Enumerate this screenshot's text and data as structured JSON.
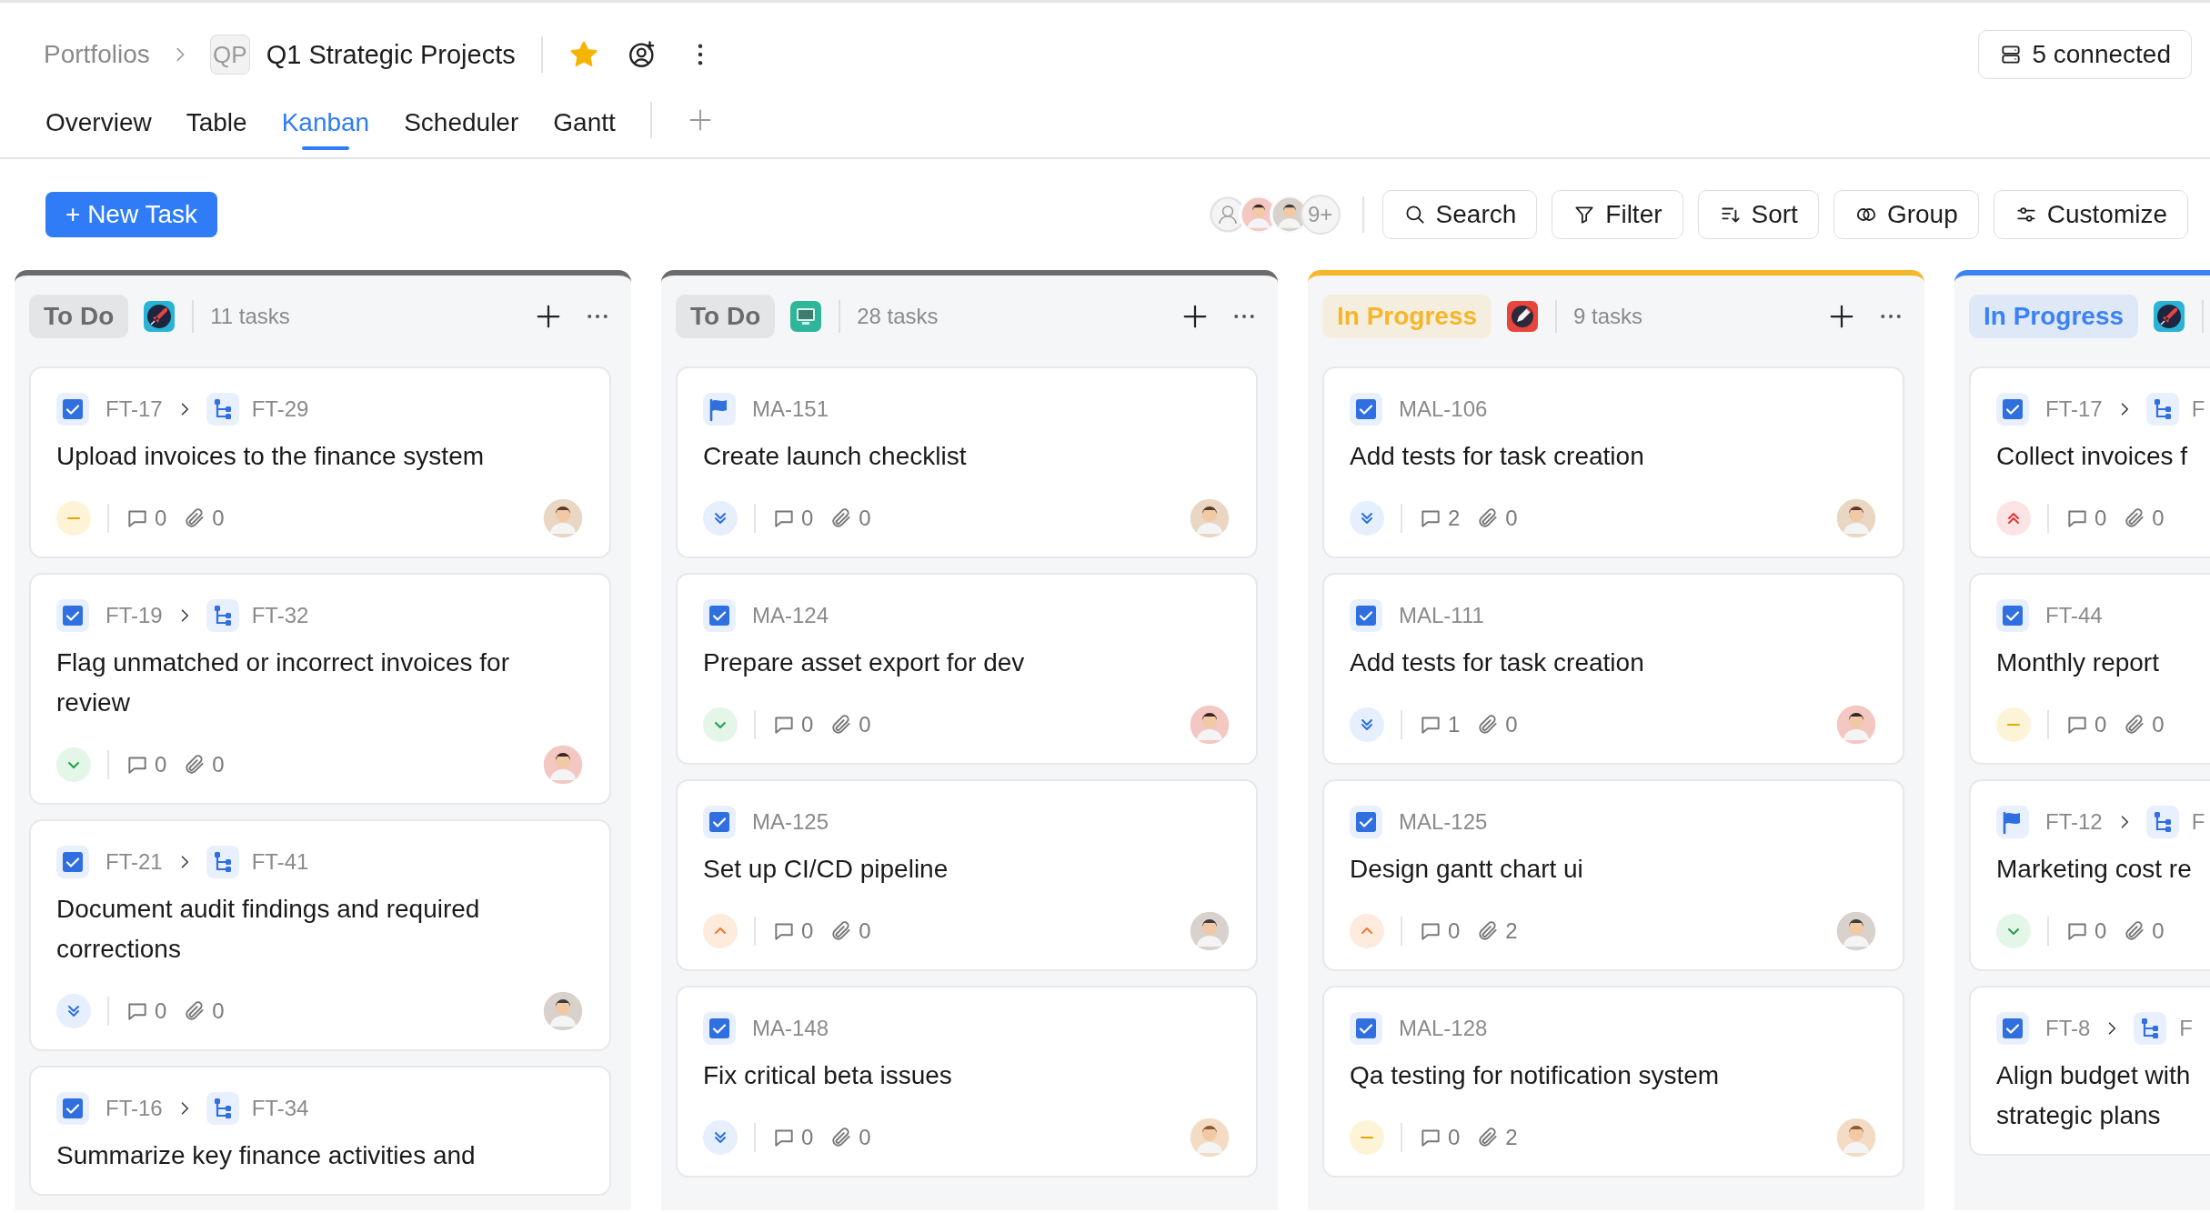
{
  "breadcrumb": {
    "parent": "Portfolios",
    "badge": "QP",
    "title": "Q1 Strategic Projects",
    "starred": true
  },
  "connections": "5 connected",
  "tabs": [
    {
      "label": "Overview",
      "selected": false
    },
    {
      "label": "Table",
      "selected": false
    },
    {
      "label": "Kanban",
      "selected": true
    },
    {
      "label": "Scheduler",
      "selected": false
    },
    {
      "label": "Gantt",
      "selected": false
    }
  ],
  "toolbar": {
    "new_task": "+ New Task",
    "members_more": "9+",
    "buttons": [
      "Search",
      "Filter",
      "Sort",
      "Group",
      "Customize"
    ]
  },
  "columns": [
    {
      "status": "To Do",
      "color": "#6b6b6b",
      "kind": "rocket",
      "count": "11 tasks",
      "cards": [
        {
          "kind": "task",
          "id": "FT-17",
          "child": "FT-29",
          "title": "Upload invoices to the finance system",
          "priority": {
            "kind": "medium"
          },
          "comments": "0",
          "attachments": "0"
        },
        {
          "kind": "task",
          "id": "FT-19",
          "child": "FT-32",
          "title": "Flag unmatched or incorrect invoices for review",
          "priority": {
            "kind": "low"
          },
          "comments": "0",
          "attachments": "0"
        },
        {
          "kind": "task",
          "id": "FT-21",
          "child": "FT-41",
          "title": "Document audit findings and required corrections",
          "priority": {
            "kind": "lowest"
          },
          "comments": "0",
          "attachments": "0"
        },
        {
          "kind": "task",
          "id": "FT-16",
          "child": "FT-34",
          "title": "Summarize key finance activities and"
        }
      ]
    },
    {
      "status": "To Do",
      "color": "#6b6b6b",
      "kind": "monitor",
      "count": "28 tasks",
      "cards": [
        {
          "kind": "milestone",
          "id": "MA-151",
          "title": "Create launch checklist",
          "priority": {
            "kind": "lowest"
          },
          "comments": "0",
          "attachments": "0"
        },
        {
          "kind": "task",
          "id": "MA-124",
          "title": "Prepare asset export for dev",
          "priority": {
            "kind": "low"
          },
          "comments": "0",
          "attachments": "0"
        },
        {
          "kind": "task",
          "id": "MA-125",
          "title": "Set up CI/CD pipeline",
          "priority": {
            "kind": "high"
          },
          "comments": "0",
          "attachments": "0"
        },
        {
          "kind": "task",
          "id": "MA-148",
          "title": "Fix critical beta issues",
          "priority": {
            "kind": "lowest"
          },
          "comments": "0",
          "attachments": "0"
        }
      ]
    },
    {
      "status": "In Progress",
      "color": "#f5b62a",
      "kind": "pen",
      "count": "9 tasks",
      "cards": [
        {
          "kind": "task",
          "id": "MAL-106",
          "title": "Add tests for task creation",
          "priority": {
            "kind": "lowest"
          },
          "comments": "2",
          "attachments": "0"
        },
        {
          "kind": "task",
          "id": "MAL-111",
          "title": "Add tests for task creation",
          "priority": {
            "kind": "lowest"
          },
          "comments": "1",
          "attachments": "0"
        },
        {
          "kind": "task",
          "id": "MAL-125",
          "title": "Design gantt chart ui",
          "priority": {
            "kind": "high"
          },
          "comments": "0",
          "attachments": "2"
        },
        {
          "kind": "task",
          "id": "MAL-128",
          "title": "Qa testing for notification system",
          "priority": {
            "kind": "medium"
          },
          "comments": "0",
          "attachments": "2"
        }
      ]
    },
    {
      "status": "In Progress",
      "color": "#3b82f6",
      "kind": "rocket",
      "cards": [
        {
          "kind": "task",
          "id": "FT-17",
          "child": "F",
          "title": "Collect invoices f",
          "priority": {
            "kind": "highest"
          },
          "comments": "0",
          "attachments": "0"
        },
        {
          "kind": "task",
          "id": "FT-44",
          "title": "Monthly report",
          "priority": {
            "kind": "medium"
          },
          "comments": "0",
          "attachments": "0"
        },
        {
          "kind": "milestone",
          "id": "FT-12",
          "child": "F",
          "title": "Marketing cost re",
          "priority": {
            "kind": "low"
          },
          "comments": "0",
          "attachments": "0"
        },
        {
          "kind": "task",
          "id": "FT-8",
          "child": "F",
          "title": "Align budget with\nstrategic plans"
        }
      ]
    }
  ]
}
